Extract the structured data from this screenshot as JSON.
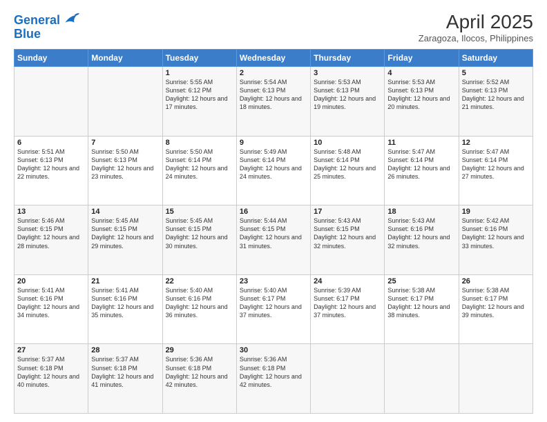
{
  "header": {
    "logo_line1": "General",
    "logo_line2": "Blue",
    "title": "April 2025",
    "subtitle": "Zaragoza, Ilocos, Philippines"
  },
  "days_of_week": [
    "Sunday",
    "Monday",
    "Tuesday",
    "Wednesday",
    "Thursday",
    "Friday",
    "Saturday"
  ],
  "weeks": [
    [
      {
        "day": "",
        "info": ""
      },
      {
        "day": "",
        "info": ""
      },
      {
        "day": "1",
        "info": "Sunrise: 5:55 AM\nSunset: 6:12 PM\nDaylight: 12 hours and 17 minutes."
      },
      {
        "day": "2",
        "info": "Sunrise: 5:54 AM\nSunset: 6:13 PM\nDaylight: 12 hours and 18 minutes."
      },
      {
        "day": "3",
        "info": "Sunrise: 5:53 AM\nSunset: 6:13 PM\nDaylight: 12 hours and 19 minutes."
      },
      {
        "day": "4",
        "info": "Sunrise: 5:53 AM\nSunset: 6:13 PM\nDaylight: 12 hours and 20 minutes."
      },
      {
        "day": "5",
        "info": "Sunrise: 5:52 AM\nSunset: 6:13 PM\nDaylight: 12 hours and 21 minutes."
      }
    ],
    [
      {
        "day": "6",
        "info": "Sunrise: 5:51 AM\nSunset: 6:13 PM\nDaylight: 12 hours and 22 minutes."
      },
      {
        "day": "7",
        "info": "Sunrise: 5:50 AM\nSunset: 6:13 PM\nDaylight: 12 hours and 23 minutes."
      },
      {
        "day": "8",
        "info": "Sunrise: 5:50 AM\nSunset: 6:14 PM\nDaylight: 12 hours and 24 minutes."
      },
      {
        "day": "9",
        "info": "Sunrise: 5:49 AM\nSunset: 6:14 PM\nDaylight: 12 hours and 24 minutes."
      },
      {
        "day": "10",
        "info": "Sunrise: 5:48 AM\nSunset: 6:14 PM\nDaylight: 12 hours and 25 minutes."
      },
      {
        "day": "11",
        "info": "Sunrise: 5:47 AM\nSunset: 6:14 PM\nDaylight: 12 hours and 26 minutes."
      },
      {
        "day": "12",
        "info": "Sunrise: 5:47 AM\nSunset: 6:14 PM\nDaylight: 12 hours and 27 minutes."
      }
    ],
    [
      {
        "day": "13",
        "info": "Sunrise: 5:46 AM\nSunset: 6:15 PM\nDaylight: 12 hours and 28 minutes."
      },
      {
        "day": "14",
        "info": "Sunrise: 5:45 AM\nSunset: 6:15 PM\nDaylight: 12 hours and 29 minutes."
      },
      {
        "day": "15",
        "info": "Sunrise: 5:45 AM\nSunset: 6:15 PM\nDaylight: 12 hours and 30 minutes."
      },
      {
        "day": "16",
        "info": "Sunrise: 5:44 AM\nSunset: 6:15 PM\nDaylight: 12 hours and 31 minutes."
      },
      {
        "day": "17",
        "info": "Sunrise: 5:43 AM\nSunset: 6:15 PM\nDaylight: 12 hours and 32 minutes."
      },
      {
        "day": "18",
        "info": "Sunrise: 5:43 AM\nSunset: 6:16 PM\nDaylight: 12 hours and 32 minutes."
      },
      {
        "day": "19",
        "info": "Sunrise: 5:42 AM\nSunset: 6:16 PM\nDaylight: 12 hours and 33 minutes."
      }
    ],
    [
      {
        "day": "20",
        "info": "Sunrise: 5:41 AM\nSunset: 6:16 PM\nDaylight: 12 hours and 34 minutes."
      },
      {
        "day": "21",
        "info": "Sunrise: 5:41 AM\nSunset: 6:16 PM\nDaylight: 12 hours and 35 minutes."
      },
      {
        "day": "22",
        "info": "Sunrise: 5:40 AM\nSunset: 6:16 PM\nDaylight: 12 hours and 36 minutes."
      },
      {
        "day": "23",
        "info": "Sunrise: 5:40 AM\nSunset: 6:17 PM\nDaylight: 12 hours and 37 minutes."
      },
      {
        "day": "24",
        "info": "Sunrise: 5:39 AM\nSunset: 6:17 PM\nDaylight: 12 hours and 37 minutes."
      },
      {
        "day": "25",
        "info": "Sunrise: 5:38 AM\nSunset: 6:17 PM\nDaylight: 12 hours and 38 minutes."
      },
      {
        "day": "26",
        "info": "Sunrise: 5:38 AM\nSunset: 6:17 PM\nDaylight: 12 hours and 39 minutes."
      }
    ],
    [
      {
        "day": "27",
        "info": "Sunrise: 5:37 AM\nSunset: 6:18 PM\nDaylight: 12 hours and 40 minutes."
      },
      {
        "day": "28",
        "info": "Sunrise: 5:37 AM\nSunset: 6:18 PM\nDaylight: 12 hours and 41 minutes."
      },
      {
        "day": "29",
        "info": "Sunrise: 5:36 AM\nSunset: 6:18 PM\nDaylight: 12 hours and 42 minutes."
      },
      {
        "day": "30",
        "info": "Sunrise: 5:36 AM\nSunset: 6:18 PM\nDaylight: 12 hours and 42 minutes."
      },
      {
        "day": "",
        "info": ""
      },
      {
        "day": "",
        "info": ""
      },
      {
        "day": "",
        "info": ""
      }
    ]
  ]
}
